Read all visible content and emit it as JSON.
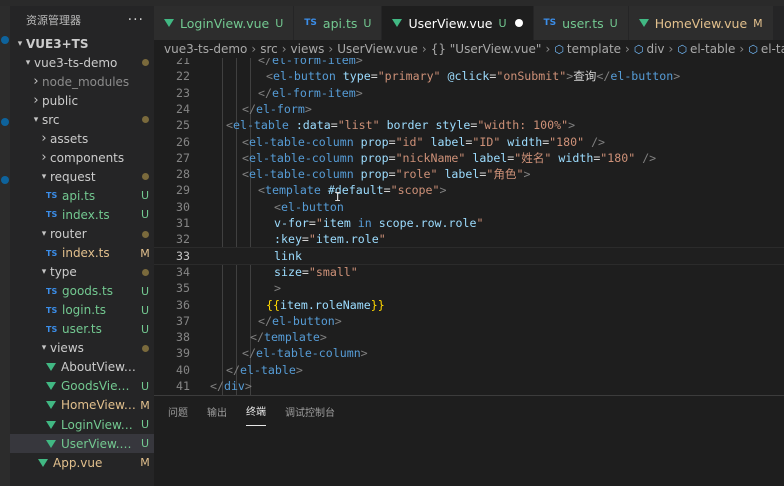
{
  "explorer": {
    "title": "资源管理器",
    "more_label": "···",
    "tree": [
      {
        "label": "VUE3+TS",
        "indent": 0,
        "kind": "folder-open",
        "status": "",
        "style": "bold"
      },
      {
        "label": "vue3-ts-demo",
        "indent": 1,
        "kind": "folder-open",
        "status": "dot",
        "style": "mod"
      },
      {
        "label": "node_modules",
        "indent": 2,
        "kind": "folder-closed",
        "status": "",
        "style": "dim"
      },
      {
        "label": "public",
        "indent": 2,
        "kind": "folder-closed",
        "status": "",
        "style": ""
      },
      {
        "label": "src",
        "indent": 2,
        "kind": "folder-open",
        "status": "dot",
        "style": "mod"
      },
      {
        "label": "assets",
        "indent": 3,
        "kind": "folder-closed",
        "status": "",
        "style": ""
      },
      {
        "label": "components",
        "indent": 3,
        "kind": "folder-closed",
        "status": "",
        "style": ""
      },
      {
        "label": "request",
        "indent": 3,
        "kind": "folder-open",
        "status": "dot",
        "style": "new"
      },
      {
        "label": "api.ts",
        "indent": 4,
        "kind": "ts",
        "status": "U",
        "style": "new"
      },
      {
        "label": "index.ts",
        "indent": 4,
        "kind": "ts",
        "status": "U",
        "style": "new"
      },
      {
        "label": "router",
        "indent": 3,
        "kind": "folder-open",
        "status": "dot",
        "style": "mod"
      },
      {
        "label": "index.ts",
        "indent": 4,
        "kind": "ts",
        "status": "M",
        "style": "mod"
      },
      {
        "label": "type",
        "indent": 3,
        "kind": "folder-open",
        "status": "dot",
        "style": "new"
      },
      {
        "label": "goods.ts",
        "indent": 4,
        "kind": "ts",
        "status": "U",
        "style": "new"
      },
      {
        "label": "login.ts",
        "indent": 4,
        "kind": "ts",
        "status": "U",
        "style": "new"
      },
      {
        "label": "user.ts",
        "indent": 4,
        "kind": "ts",
        "status": "U",
        "style": "new"
      },
      {
        "label": "views",
        "indent": 3,
        "kind": "folder-open",
        "status": "dot",
        "style": "mod"
      },
      {
        "label": "AboutView.vue",
        "indent": 4,
        "kind": "vue",
        "status": "",
        "style": ""
      },
      {
        "label": "GoodsView....",
        "indent": 4,
        "kind": "vue",
        "status": "U",
        "style": "new"
      },
      {
        "label": "HomeView....",
        "indent": 4,
        "kind": "vue",
        "status": "M",
        "style": "mod"
      },
      {
        "label": "LoginView.vue",
        "indent": 4,
        "kind": "vue",
        "status": "U",
        "style": "new"
      },
      {
        "label": "UserView.vue",
        "indent": 4,
        "kind": "vue",
        "status": "U",
        "style": "new",
        "selected": true
      },
      {
        "label": "App.vue",
        "indent": 3,
        "kind": "vue",
        "status": "M",
        "style": "mod"
      }
    ]
  },
  "tabs": [
    {
      "name": "LoginView.vue",
      "icon": "vue",
      "badge": "U",
      "badge_type": "u",
      "active": false
    },
    {
      "name": "api.ts",
      "icon": "ts",
      "badge": "U",
      "badge_type": "u",
      "active": false
    },
    {
      "name": "UserView.vue",
      "icon": "vue",
      "badge": "U",
      "badge_type": "u",
      "active": true,
      "unsaved": true
    },
    {
      "name": "user.ts",
      "icon": "ts",
      "badge": "U",
      "badge_type": "u",
      "active": false
    },
    {
      "name": "HomeView.vue",
      "icon": "vue",
      "badge": "M",
      "badge_type": "m",
      "active": false
    }
  ],
  "breadcrumb": [
    "vue3-ts-demo",
    "src",
    "views",
    "UserView.vue",
    "{} \"UserView.vue\"",
    "template",
    "div",
    "el-table",
    "el-table-column"
  ],
  "code": {
    "current_line": 33,
    "lines": [
      {
        "n": "21",
        "tokens": [
          [
            "punc",
            "</"
          ],
          [
            "tag",
            "el-form-item"
          ],
          [
            "punc",
            ">"
          ]
        ]
      },
      {
        "n": "22",
        "tokens": [
          [
            "punc",
            "<"
          ],
          [
            "tag",
            "el-button"
          ],
          [
            "text",
            " "
          ],
          [
            "attr",
            "type"
          ],
          [
            "text",
            "="
          ],
          [
            "str",
            "\"primary\""
          ],
          [
            "text",
            " "
          ],
          [
            "attr",
            "@click"
          ],
          [
            "text",
            "="
          ],
          [
            "str",
            "\"onSubmit\""
          ],
          [
            "punc",
            ">"
          ],
          [
            "text",
            "查询"
          ],
          [
            "punc",
            "</"
          ],
          [
            "tag",
            "el-button"
          ],
          [
            "punc",
            ">"
          ]
        ]
      },
      {
        "n": "23",
        "tokens": [
          [
            "punc",
            "</"
          ],
          [
            "tag",
            "el-form-item"
          ],
          [
            "punc",
            ">"
          ]
        ]
      },
      {
        "n": "24",
        "tokens": [
          [
            "punc",
            "</"
          ],
          [
            "tag",
            "el-form"
          ],
          [
            "punc",
            ">"
          ]
        ]
      },
      {
        "n": "25",
        "tokens": [
          [
            "punc",
            "<"
          ],
          [
            "tag",
            "el-table"
          ],
          [
            "text",
            " "
          ],
          [
            "attr",
            ":data"
          ],
          [
            "text",
            "="
          ],
          [
            "str",
            "\"list\""
          ],
          [
            "text",
            " "
          ],
          [
            "attr",
            "border"
          ],
          [
            "text",
            " "
          ],
          [
            "attr",
            "style"
          ],
          [
            "text",
            "="
          ],
          [
            "str",
            "\"width: 100%\""
          ],
          [
            "punc",
            ">"
          ]
        ]
      },
      {
        "n": "26",
        "tokens": [
          [
            "punc",
            "<"
          ],
          [
            "tag",
            "el-table-column"
          ],
          [
            "text",
            " "
          ],
          [
            "attr",
            "prop"
          ],
          [
            "text",
            "="
          ],
          [
            "str",
            "\"id\""
          ],
          [
            "text",
            " "
          ],
          [
            "attr",
            "label"
          ],
          [
            "text",
            "="
          ],
          [
            "str",
            "\"ID\""
          ],
          [
            "text",
            " "
          ],
          [
            "attr",
            "width"
          ],
          [
            "text",
            "="
          ],
          [
            "str",
            "\"180\""
          ],
          [
            "text",
            " "
          ],
          [
            "punc",
            "/>"
          ]
        ]
      },
      {
        "n": "27",
        "tokens": [
          [
            "punc",
            "<"
          ],
          [
            "tag",
            "el-table-column"
          ],
          [
            "text",
            " "
          ],
          [
            "attr",
            "prop"
          ],
          [
            "text",
            "="
          ],
          [
            "str",
            "\"nickName\""
          ],
          [
            "text",
            " "
          ],
          [
            "attr",
            "label"
          ],
          [
            "text",
            "="
          ],
          [
            "str",
            "\"姓名\""
          ],
          [
            "text",
            " "
          ],
          [
            "attr",
            "width"
          ],
          [
            "text",
            "="
          ],
          [
            "str",
            "\"180\""
          ],
          [
            "text",
            " "
          ],
          [
            "punc",
            "/>"
          ]
        ]
      },
      {
        "n": "28",
        "tokens": [
          [
            "punc",
            "<"
          ],
          [
            "tag",
            "el-table-column"
          ],
          [
            "text",
            " "
          ],
          [
            "attr",
            "prop"
          ],
          [
            "text",
            "="
          ],
          [
            "str",
            "\"role\""
          ],
          [
            "text",
            " "
          ],
          [
            "attr",
            "label"
          ],
          [
            "text",
            "="
          ],
          [
            "str",
            "\"角色\""
          ],
          [
            "punc",
            ">"
          ]
        ]
      },
      {
        "n": "29",
        "tokens": [
          [
            "punc",
            "<"
          ],
          [
            "tag",
            "template"
          ],
          [
            "text",
            " "
          ],
          [
            "attr",
            "#default"
          ],
          [
            "text",
            "="
          ],
          [
            "str",
            "\"scope\""
          ],
          [
            "punc",
            ">"
          ]
        ]
      },
      {
        "n": "30",
        "tokens": [
          [
            "punc",
            "<"
          ],
          [
            "tag",
            "el-button"
          ]
        ]
      },
      {
        "n": "31",
        "tokens": [
          [
            "attr",
            "v-for"
          ],
          [
            "text",
            "="
          ],
          [
            "str",
            "\""
          ],
          [
            "attr",
            "item"
          ],
          [
            "kw",
            " in "
          ],
          [
            "attr",
            "scope.row.role"
          ],
          [
            "str",
            "\""
          ]
        ]
      },
      {
        "n": "32",
        "tokens": [
          [
            "attr",
            ":key"
          ],
          [
            "text",
            "="
          ],
          [
            "str",
            "\""
          ],
          [
            "attr",
            "item.role"
          ],
          [
            "str",
            "\""
          ]
        ]
      },
      {
        "n": "33",
        "tokens": [
          [
            "attr",
            "link"
          ]
        ]
      },
      {
        "n": "34",
        "tokens": [
          [
            "attr",
            "size"
          ],
          [
            "text",
            "="
          ],
          [
            "str",
            "\"small\""
          ]
        ]
      },
      {
        "n": "35",
        "tokens": [
          [
            "punc",
            ">"
          ]
        ]
      },
      {
        "n": "36",
        "tokens": [
          [
            "brace",
            "{{"
          ],
          [
            "attr",
            "item.roleName"
          ],
          [
            "brace",
            "}}"
          ]
        ]
      },
      {
        "n": "37",
        "tokens": [
          [
            "punc",
            "</"
          ],
          [
            "tag",
            "el-button"
          ],
          [
            "punc",
            ">"
          ]
        ]
      },
      {
        "n": "38",
        "tokens": [
          [
            "punc",
            "</"
          ],
          [
            "tag",
            "template"
          ],
          [
            "punc",
            ">"
          ]
        ]
      },
      {
        "n": "39",
        "tokens": [
          [
            "punc",
            "</"
          ],
          [
            "tag",
            "el-table-column"
          ],
          [
            "punc",
            ">"
          ]
        ]
      },
      {
        "n": "40",
        "tokens": [
          [
            "punc",
            "</"
          ],
          [
            "tag",
            "el-table"
          ],
          [
            "punc",
            ">"
          ]
        ]
      },
      {
        "n": "41",
        "tokens": [
          [
            "punc",
            "</"
          ],
          [
            "tag",
            "div"
          ],
          [
            "punc",
            ">"
          ]
        ]
      }
    ]
  },
  "panel": {
    "tabs": [
      {
        "label": "问题",
        "active": false
      },
      {
        "label": "输出",
        "active": false
      },
      {
        "label": "终端",
        "active": true
      },
      {
        "label": "调试控制台",
        "active": false
      }
    ]
  },
  "cursor_icon": "i-beam-cursor-icon"
}
